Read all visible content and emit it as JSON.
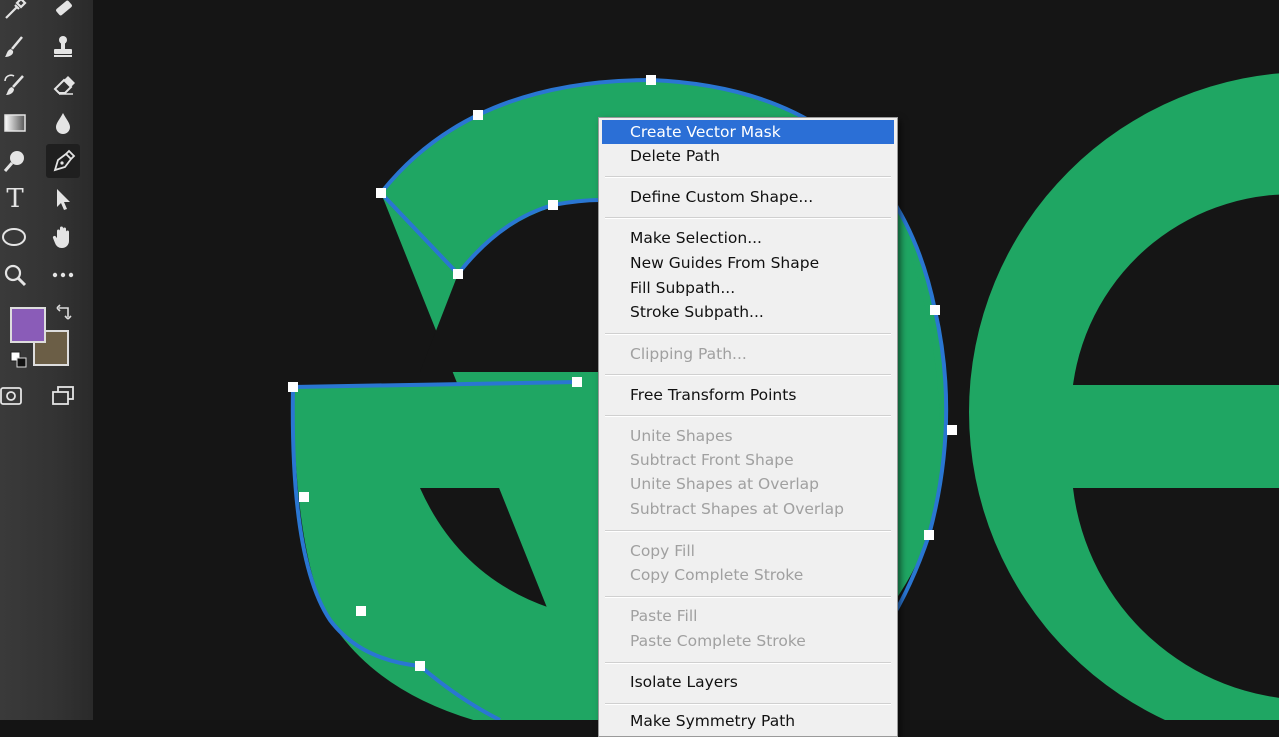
{
  "toolbar": {
    "tools": [
      {
        "name": "eyedropper-icon"
      },
      {
        "name": "patch-tool-icon"
      },
      {
        "name": "brush-icon"
      },
      {
        "name": "clone-stamp-icon"
      },
      {
        "name": "history-brush-icon"
      },
      {
        "name": "eraser-icon"
      },
      {
        "name": "gradient-icon"
      },
      {
        "name": "blur-drop-icon"
      },
      {
        "name": "dodge-icon"
      },
      {
        "name": "pen-tool-icon"
      },
      {
        "name": "type-tool-icon",
        "letter": "T"
      },
      {
        "name": "path-selection-icon"
      },
      {
        "name": "ellipse-shape-icon"
      },
      {
        "name": "hand-icon"
      },
      {
        "name": "zoom-icon"
      },
      {
        "name": "more-tools-icon"
      }
    ],
    "foreground_color": "#8a5cb8",
    "background_color": "#6b5e46"
  },
  "canvas": {
    "background_color": "#151515",
    "shape_color": "#1fa663",
    "path_color": "#2a76d2"
  },
  "context_menu": {
    "items": [
      {
        "label": "Create Vector Mask",
        "enabled": true,
        "highlighted": true
      },
      {
        "label": "Delete Path",
        "enabled": true
      },
      {
        "label": "Define Custom Shape...",
        "enabled": true
      },
      {
        "label": "Make Selection...",
        "enabled": true
      },
      {
        "label": "New Guides From Shape",
        "enabled": true
      },
      {
        "label": "Fill Subpath...",
        "enabled": true
      },
      {
        "label": "Stroke Subpath...",
        "enabled": true
      },
      {
        "label": "Clipping Path...",
        "enabled": false
      },
      {
        "label": "Free Transform Points",
        "enabled": true
      },
      {
        "label": "Unite Shapes",
        "enabled": false
      },
      {
        "label": "Subtract Front Shape",
        "enabled": false
      },
      {
        "label": "Unite Shapes at Overlap",
        "enabled": false
      },
      {
        "label": "Subtract Shapes at Overlap",
        "enabled": false
      },
      {
        "label": "Copy Fill",
        "enabled": false
      },
      {
        "label": "Copy Complete Stroke",
        "enabled": false
      },
      {
        "label": "Paste Fill",
        "enabled": false
      },
      {
        "label": "Paste Complete Stroke",
        "enabled": false
      },
      {
        "label": "Isolate Layers",
        "enabled": true
      },
      {
        "label": "Make Symmetry Path",
        "enabled": true
      }
    ]
  }
}
